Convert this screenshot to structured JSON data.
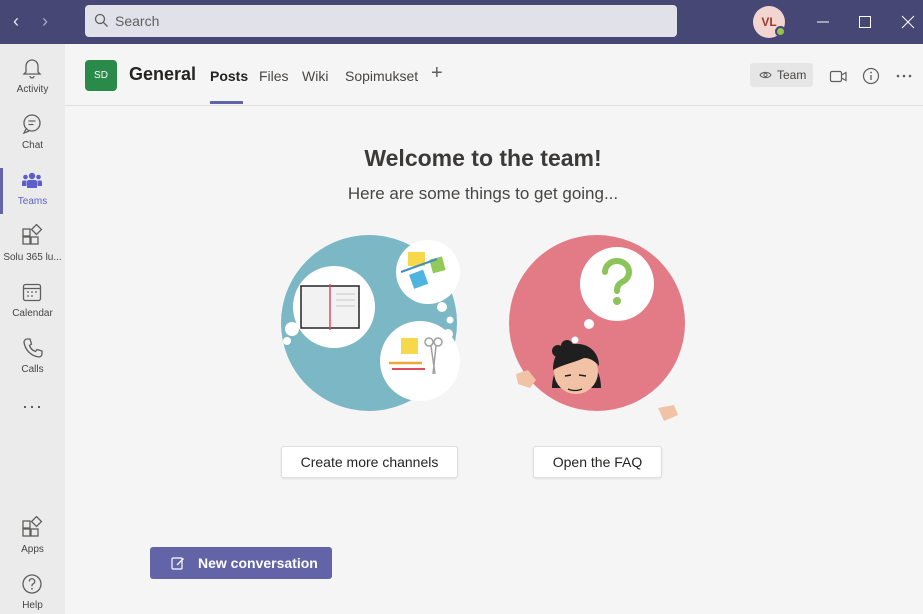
{
  "titlebar": {
    "search_placeholder": "Search",
    "avatar_initials": "VL"
  },
  "rail": {
    "items": [
      {
        "label": "Activity",
        "icon": "bell-icon"
      },
      {
        "label": "Chat",
        "icon": "chat-icon"
      },
      {
        "label": "Teams",
        "icon": "teams-icon",
        "active": true
      },
      {
        "label": "Solu 365 lu...",
        "icon": "app-icon"
      },
      {
        "label": "Calendar",
        "icon": "calendar-icon"
      },
      {
        "label": "Calls",
        "icon": "phone-icon"
      }
    ],
    "more": "···",
    "bottom": [
      {
        "label": "Apps",
        "icon": "apps-icon"
      },
      {
        "label": "Help",
        "icon": "help-icon"
      }
    ]
  },
  "channel": {
    "team_initials": "SD",
    "title": "General",
    "tabs": [
      "Posts",
      "Files",
      "Wiki",
      "Sopimukset"
    ],
    "team_pill": "Team"
  },
  "main": {
    "title": "Welcome to the team!",
    "subtitle": "Here are some things to get going...",
    "btn_channels": "Create more channels",
    "btn_faq": "Open the FAQ",
    "new_conversation": "New conversation"
  },
  "colors": {
    "titlebar": "#464775",
    "accent": "#6264a7",
    "teal_circle": "#7bb7c4",
    "pink_circle": "#e27b86"
  }
}
